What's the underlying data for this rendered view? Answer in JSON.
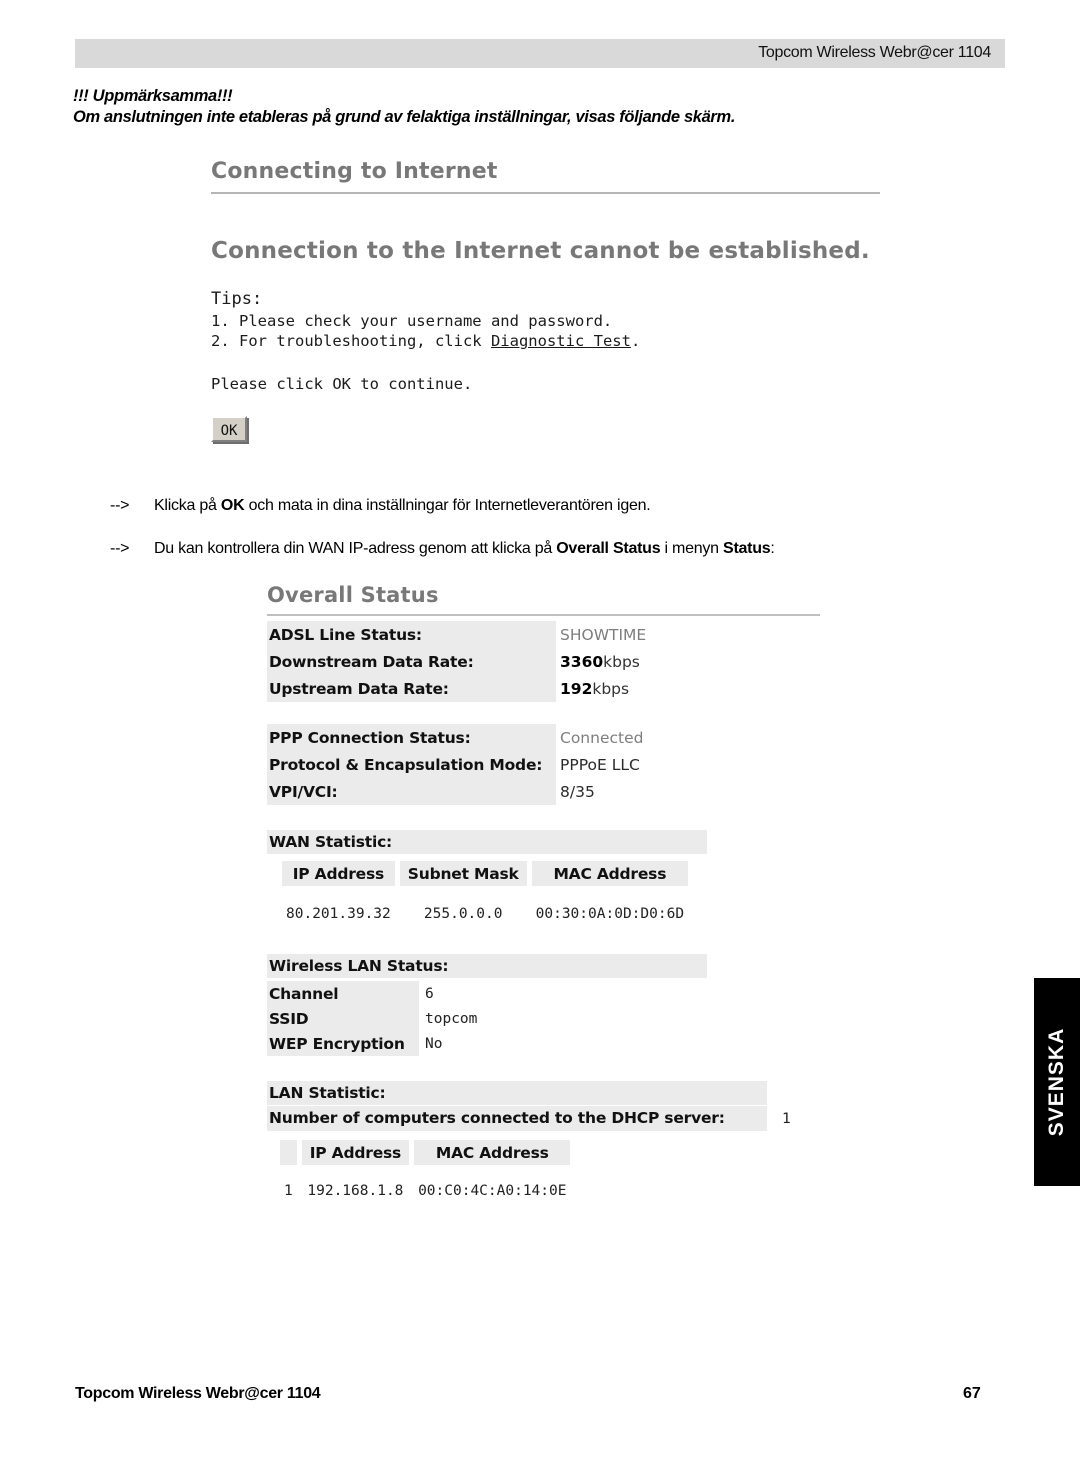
{
  "header": {
    "title": "Topcom Wireless Webr@cer 1104"
  },
  "warning": {
    "line1": "!!! Uppmärksamma!!!",
    "line2": "Om anslutningen inte etableras på grund av felaktiga inställningar, visas följande skärm."
  },
  "connect_screen": {
    "title": "Connecting to Internet",
    "message": "Connection to the Internet cannot be established.",
    "tips_label": "Tips:",
    "tip1": "1. Please check your username and password.",
    "tip2_prefix": "2. For troubleshooting, click ",
    "tip2_link": "Diagnostic Test",
    "tip2_suffix": ".",
    "continue_text": "Please click OK to continue.",
    "ok_button": "OK"
  },
  "instructions": {
    "arrow": "-->",
    "item1": {
      "part1": "Klicka på ",
      "bold1": "OK",
      "part2": " och mata in dina inställningar för Internetleverantören igen."
    },
    "item2": {
      "part1": "Du kan kontrollera din WAN IP-adress genom att klicka på ",
      "bold1": "Overall Status",
      "part2": " i menyn ",
      "bold2": "Status",
      "part3": ":"
    }
  },
  "status_screen": {
    "title": "Overall Status",
    "adsl": [
      {
        "label": "ADSL Line Status:",
        "value": "SHOWTIME",
        "style": "muted"
      },
      {
        "label": "Downstream Data Rate:",
        "value_strong": "3360",
        "value_rest": "kbps"
      },
      {
        "label": "Upstream Data Rate:",
        "value_strong": "192",
        "value_rest": "kbps"
      }
    ],
    "ppp": [
      {
        "label": "PPP Connection Status:",
        "value": "Connected",
        "style": "muted"
      },
      {
        "label": "Protocol & Encapsulation Mode:",
        "value": "PPPoE LLC",
        "style": "dark"
      },
      {
        "label": "VPI/VCI:",
        "value": "8/35",
        "style": "dark"
      }
    ],
    "wan": {
      "section_label": "WAN Statistic:",
      "columns": [
        "IP Address",
        "Subnet Mask",
        "MAC Address"
      ],
      "rows": [
        [
          "80.201.39.32",
          "255.0.0.0",
          "00:30:0A:0D:D0:6D"
        ]
      ]
    },
    "wlan": {
      "section_label": "Wireless LAN Status:",
      "rows": [
        {
          "label": "Channel",
          "value": "6"
        },
        {
          "label": "SSID",
          "value": "topcom"
        },
        {
          "label": "WEP Encryption",
          "value": "No"
        }
      ]
    },
    "lan": {
      "section_label": "LAN Statistic:",
      "dhcp_label": "Number of computers connected to the DHCP server:",
      "dhcp_count": "1",
      "columns": [
        "",
        "IP Address",
        "MAC Address"
      ],
      "rows": [
        [
          "1",
          "192.168.1.8",
          "00:C0:4C:A0:14:0E"
        ]
      ]
    }
  },
  "side_tab": {
    "label": "SVENSKA"
  },
  "footer": {
    "left": "Topcom Wireless Webr@cer 1104",
    "page_number": "67"
  },
  "colors": {
    "header_bar": "#d9d9d9",
    "ui_heading": "#787878",
    "cell_gray": "#ebebeb",
    "tab_black": "#000000"
  }
}
